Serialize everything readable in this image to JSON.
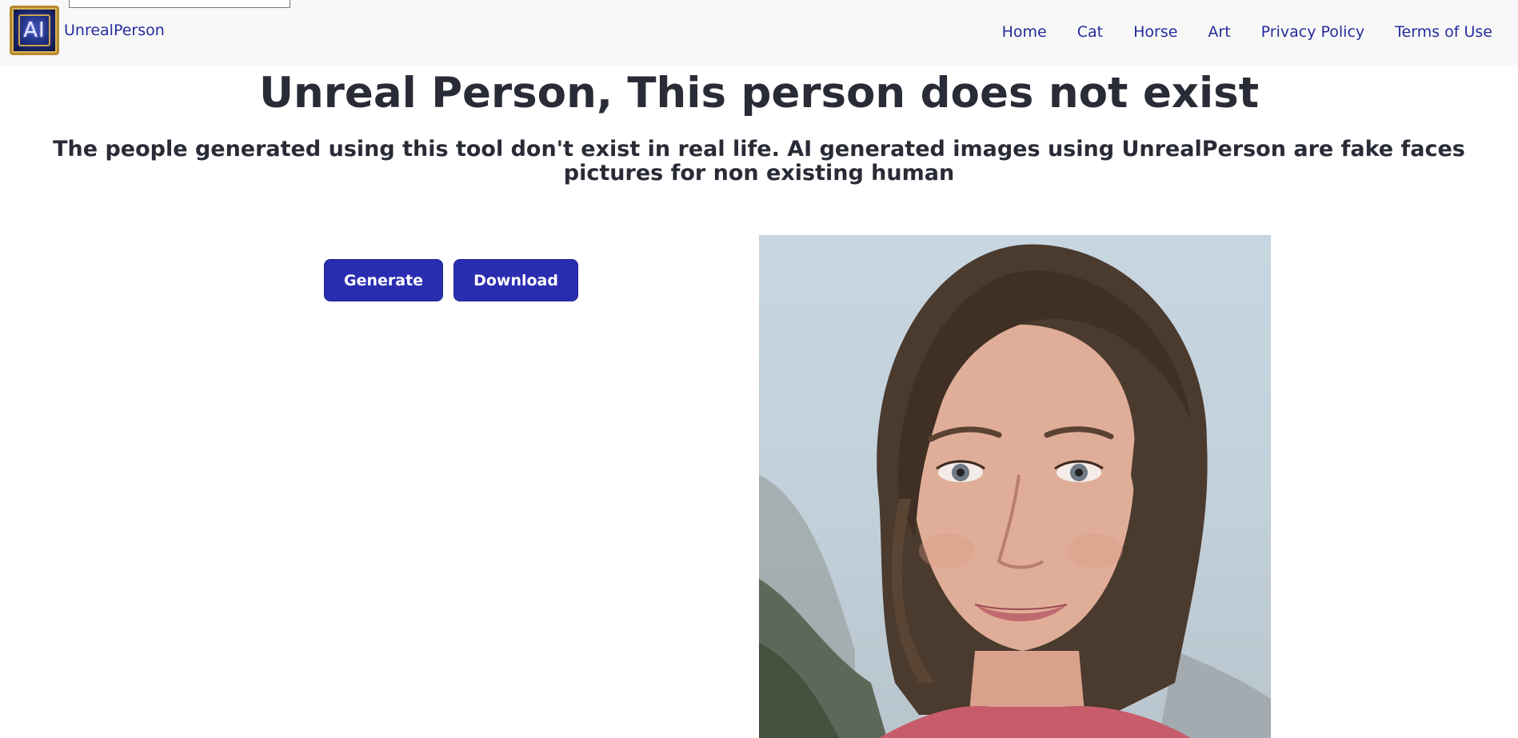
{
  "header": {
    "brand_logo_text": "AI",
    "brand_name": "UnrealPerson",
    "nav": [
      {
        "label": "Home"
      },
      {
        "label": "Cat"
      },
      {
        "label": "Horse"
      },
      {
        "label": "Art"
      },
      {
        "label": "Privacy Policy"
      },
      {
        "label": "Terms of Use"
      }
    ]
  },
  "main": {
    "title": "Unreal Person, This person does not exist",
    "subtitle": "The people generated using this tool don't exist in real life. AI generated images using UnrealPerson are fake faces pictures for non existing human",
    "generate_label": "Generate",
    "download_label": "Download"
  },
  "colors": {
    "accent": "#2a2db0",
    "link": "#252b9c",
    "navbar_bg": "#f8f8f8",
    "text": "#292b36"
  },
  "icons": {
    "logo": "ai-chip-logo-icon"
  }
}
